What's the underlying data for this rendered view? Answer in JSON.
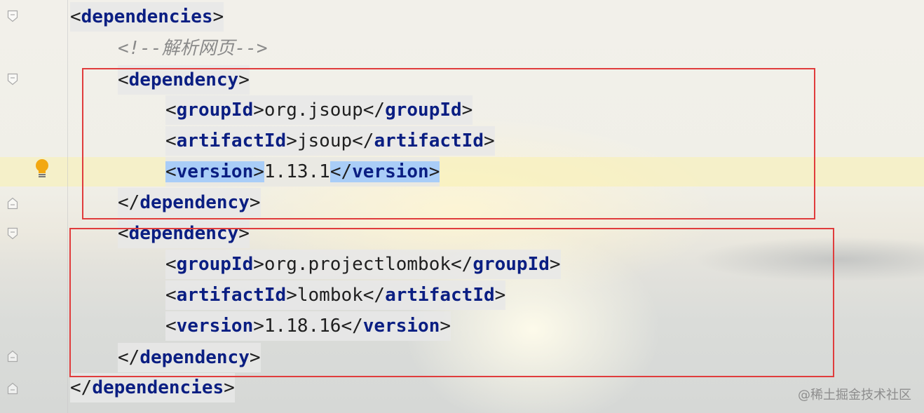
{
  "editor": {
    "lines": [
      {
        "parts": [
          {
            "t": "<",
            "c": "br"
          },
          {
            "t": "dependencies",
            "c": "tag"
          },
          {
            "t": ">",
            "c": "br"
          }
        ]
      },
      {
        "parts": [
          {
            "t": "<!--解析网页-->",
            "c": "cmt"
          }
        ]
      },
      {
        "parts": [
          {
            "t": "<",
            "c": "br"
          },
          {
            "t": "dependency",
            "c": "tag"
          },
          {
            "t": ">",
            "c": "br"
          }
        ]
      },
      {
        "parts": [
          {
            "t": "<",
            "c": "br"
          },
          {
            "t": "groupId",
            "c": "tag"
          },
          {
            "t": ">",
            "c": "br"
          },
          {
            "t": "org.jsoup",
            "c": "txt"
          },
          {
            "t": "</",
            "c": "br"
          },
          {
            "t": "groupId",
            "c": "tag"
          },
          {
            "t": ">",
            "c": "br"
          }
        ]
      },
      {
        "parts": [
          {
            "t": "<",
            "c": "br"
          },
          {
            "t": "artifactId",
            "c": "tag"
          },
          {
            "t": ">",
            "c": "br"
          },
          {
            "t": "jsoup",
            "c": "txt"
          },
          {
            "t": "</",
            "c": "br"
          },
          {
            "t": "artifactId",
            "c": "tag"
          },
          {
            "t": ">",
            "c": "br"
          }
        ]
      },
      {
        "parts": [
          {
            "t": "<",
            "c": "br",
            "sel": true
          },
          {
            "t": "version",
            "c": "tag",
            "sel": true
          },
          {
            "t": ">",
            "c": "br",
            "sel": true
          },
          {
            "t": "1.13.1",
            "c": "txt"
          },
          {
            "t": "</",
            "c": "br",
            "sel": true
          },
          {
            "t": "version",
            "c": "tag",
            "sel": true
          },
          {
            "t": ">",
            "c": "br",
            "sel": true
          }
        ]
      },
      {
        "parts": [
          {
            "t": "</",
            "c": "br"
          },
          {
            "t": "dependency",
            "c": "tag"
          },
          {
            "t": ">",
            "c": "br"
          }
        ]
      },
      {
        "parts": [
          {
            "t": "<",
            "c": "br"
          },
          {
            "t": "dependency",
            "c": "tag"
          },
          {
            "t": ">",
            "c": "br"
          }
        ]
      },
      {
        "parts": [
          {
            "t": "<",
            "c": "br"
          },
          {
            "t": "groupId",
            "c": "tag"
          },
          {
            "t": ">",
            "c": "br"
          },
          {
            "t": "org.projectlombok",
            "c": "txt"
          },
          {
            "t": "</",
            "c": "br"
          },
          {
            "t": "groupId",
            "c": "tag"
          },
          {
            "t": ">",
            "c": "br"
          }
        ]
      },
      {
        "parts": [
          {
            "t": "<",
            "c": "br"
          },
          {
            "t": "artifactId",
            "c": "tag"
          },
          {
            "t": ">",
            "c": "br"
          },
          {
            "t": "lombok",
            "c": "txt"
          },
          {
            "t": "</",
            "c": "br"
          },
          {
            "t": "artifactId",
            "c": "tag"
          },
          {
            "t": ">",
            "c": "br"
          }
        ]
      },
      {
        "parts": [
          {
            "t": "<",
            "c": "br"
          },
          {
            "t": "version",
            "c": "tag"
          },
          {
            "t": ">",
            "c": "br"
          },
          {
            "t": "1.18.16",
            "c": "txt"
          },
          {
            "t": "</",
            "c": "br"
          },
          {
            "t": "version",
            "c": "tag"
          },
          {
            "t": ">",
            "c": "br"
          }
        ]
      },
      {
        "parts": [
          {
            "t": "</",
            "c": "br"
          },
          {
            "t": "dependency",
            "c": "tag"
          },
          {
            "t": ">",
            "c": "br"
          }
        ]
      },
      {
        "parts": [
          {
            "t": "</",
            "c": "br"
          },
          {
            "t": "dependencies",
            "c": "tag"
          },
          {
            "t": ">",
            "c": "br"
          }
        ]
      }
    ],
    "intention_icon": "lightbulb-icon"
  },
  "watermark": "@稀土掘金技术社区",
  "colors": {
    "tag": "#0a1e82",
    "highlight_box": "#e03c3c",
    "selection": "#a9cdf7"
  }
}
